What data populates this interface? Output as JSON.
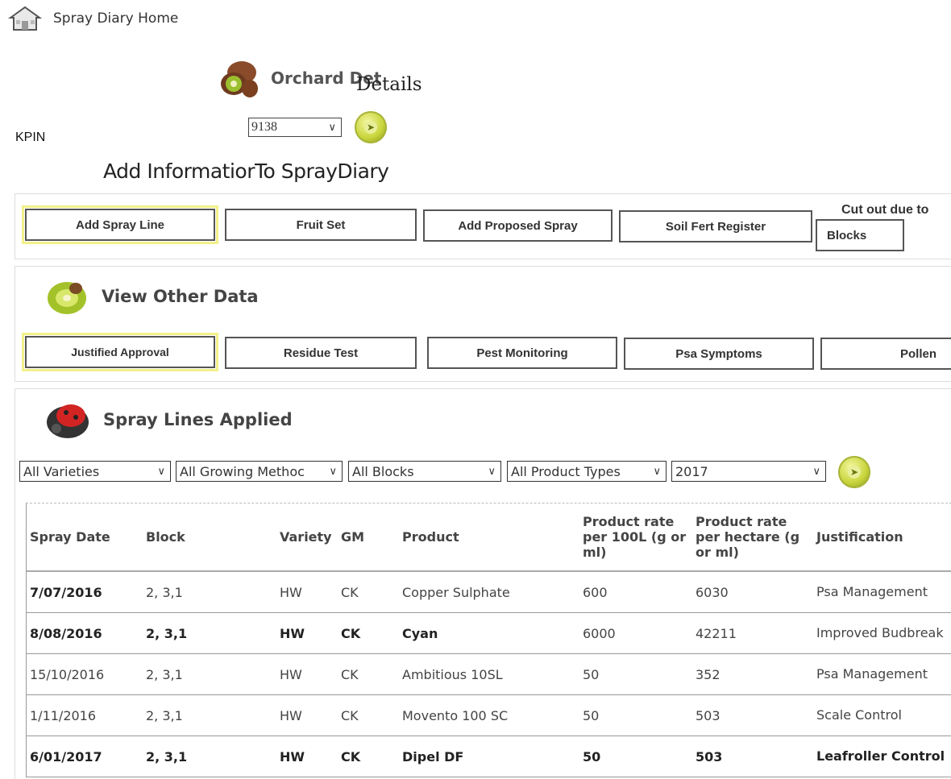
{
  "header": {
    "home_label": "Spray Diary Home",
    "orchard_title": "Orchard Det",
    "details_overlay": "Details",
    "kpin_label": "KPIN",
    "kpin_value": "9138",
    "add_info_title": "Add InformatiorTo SprayDiary"
  },
  "add_buttons": [
    "Add Spray Line",
    "Fruit Set",
    "Add Proposed Spray",
    "Soil Fert Register",
    "Blocks"
  ],
  "cut_note": "Cut out due to",
  "view_other": {
    "title": "View Other Data",
    "buttons": [
      "Justified Approval",
      "Residue Test",
      "Pest Monitoring",
      "Psa Symptoms",
      "Pollen"
    ]
  },
  "spray_lines": {
    "title": "Spray Lines Applied",
    "filters": {
      "varieties": "All Varieties",
      "growing": "All Growing Methoc",
      "blocks": "All Blocks",
      "product_types": "All Product Types",
      "year": "2017"
    },
    "columns": {
      "date": "Spray Date",
      "block": "Block",
      "variety": "Variety",
      "gm": "GM",
      "product": "Product",
      "rate100": "Product rate per 100L (g or ml)",
      "rateha": "Product rate per hectare (g or ml)",
      "just": "Justification"
    },
    "rows": [
      {
        "date": "7/07/2016",
        "block": "2, 3,1",
        "variety": "HW",
        "gm": "CK",
        "product": "Copper Sulphate",
        "rate100": "600",
        "rateha": "6030",
        "just": "Psa Management"
      },
      {
        "date": "8/08/2016",
        "block": "2, 3,1",
        "variety": "HW",
        "gm": "CK",
        "product": "Cyan",
        "rate100": "6000",
        "rateha": "42211",
        "just": "Improved Budbreak"
      },
      {
        "date": "15/10/2016",
        "block": "2, 3,1",
        "variety": "HW",
        "gm": "CK",
        "product": "Ambitious 10SL",
        "rate100": "50",
        "rateha": "352",
        "just": "Psa Management"
      },
      {
        "date": "1/11/2016",
        "block": "2, 3,1",
        "variety": "HW",
        "gm": "CK",
        "product": "Movento 100 SC",
        "rate100": "50",
        "rateha": "503",
        "just": "Scale Control"
      },
      {
        "date": "6/01/2017",
        "block": "2, 3,1",
        "variety": "HW",
        "gm": "CK",
        "product": "Dipel DF",
        "rate100": "50",
        "rateha": "503",
        "just": "Leafroller Control"
      }
    ]
  },
  "colors": {
    "highlight": "#f3f08a",
    "go_button": "#c8d43a"
  }
}
